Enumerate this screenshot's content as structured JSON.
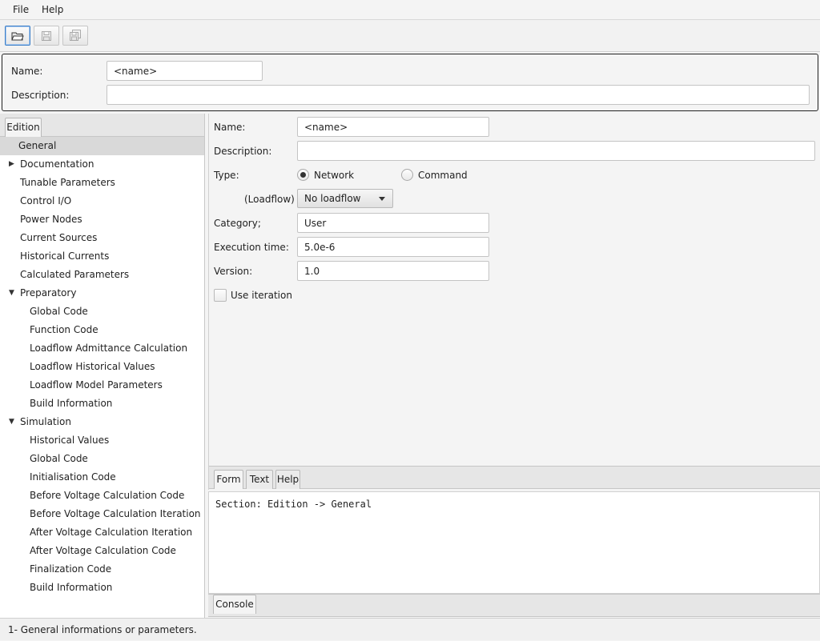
{
  "menu": {
    "file": "File",
    "help": "Help"
  },
  "toolbar": {
    "open_icon": "open-folder-icon",
    "save_icon": "save-icon",
    "save_as_icon": "save-all-icon"
  },
  "header": {
    "name_label": "Name:",
    "name_value": "<name>",
    "description_label": "Description:",
    "description_value": ""
  },
  "left_tabs": {
    "edition": "Edition"
  },
  "tree": {
    "items": [
      {
        "label": "General",
        "level": 1,
        "expander": "",
        "selected": true
      },
      {
        "label": "Documentation",
        "level": 1,
        "expander": "collapsed"
      },
      {
        "label": "Tunable Parameters",
        "level": 1,
        "expander": ""
      },
      {
        "label": "Control I/O",
        "level": 1,
        "expander": ""
      },
      {
        "label": "Power Nodes",
        "level": 1,
        "expander": ""
      },
      {
        "label": "Current Sources",
        "level": 1,
        "expander": ""
      },
      {
        "label": "Historical Currents",
        "level": 1,
        "expander": ""
      },
      {
        "label": "Calculated Parameters",
        "level": 1,
        "expander": ""
      },
      {
        "label": "Preparatory",
        "level": 1,
        "expander": "expanded"
      },
      {
        "label": "Global Code",
        "level": 2,
        "expander": ""
      },
      {
        "label": "Function Code",
        "level": 2,
        "expander": ""
      },
      {
        "label": "Loadflow Admittance Calculation",
        "level": 2,
        "expander": ""
      },
      {
        "label": "Loadflow Historical Values",
        "level": 2,
        "expander": ""
      },
      {
        "label": "Loadflow Model Parameters",
        "level": 2,
        "expander": ""
      },
      {
        "label": "Build Information",
        "level": 2,
        "expander": ""
      },
      {
        "label": "Simulation",
        "level": 1,
        "expander": "expanded"
      },
      {
        "label": "Historical Values",
        "level": 2,
        "expander": ""
      },
      {
        "label": "Global Code",
        "level": 2,
        "expander": ""
      },
      {
        "label": "Initialisation Code",
        "level": 2,
        "expander": ""
      },
      {
        "label": "Before Voltage Calculation Code",
        "level": 2,
        "expander": ""
      },
      {
        "label": "Before Voltage Calculation Iteration",
        "level": 2,
        "expander": ""
      },
      {
        "label": "After Voltage Calculation Iteration",
        "level": 2,
        "expander": ""
      },
      {
        "label": "After Voltage Calculation Code",
        "level": 2,
        "expander": ""
      },
      {
        "label": "Finalization Code",
        "level": 2,
        "expander": ""
      },
      {
        "label": "Build Information",
        "level": 2,
        "expander": ""
      }
    ]
  },
  "form": {
    "name_label": "Name:",
    "name_value": "<name>",
    "description_label": "Description:",
    "description_value": "",
    "type_label": "Type:",
    "type_network": "Network",
    "type_command": "Command",
    "type_selected": "Network",
    "loadflow_label": "(Loadflow)",
    "loadflow_value": "No loadflow",
    "category_label": "Category;",
    "category_value": "User",
    "execution_label": "Execution time:",
    "execution_value": "5.0e-6",
    "version_label": "Version:",
    "version_value": "1.0",
    "use_iteration_label": "Use iteration",
    "use_iteration_checked": false
  },
  "form_tabs": {
    "form": "Form",
    "text": "Text",
    "help": "Help"
  },
  "console": {
    "text": "Section: Edition -> General",
    "tab": "Console"
  },
  "status": {
    "text": "1- General informations or parameters."
  }
}
